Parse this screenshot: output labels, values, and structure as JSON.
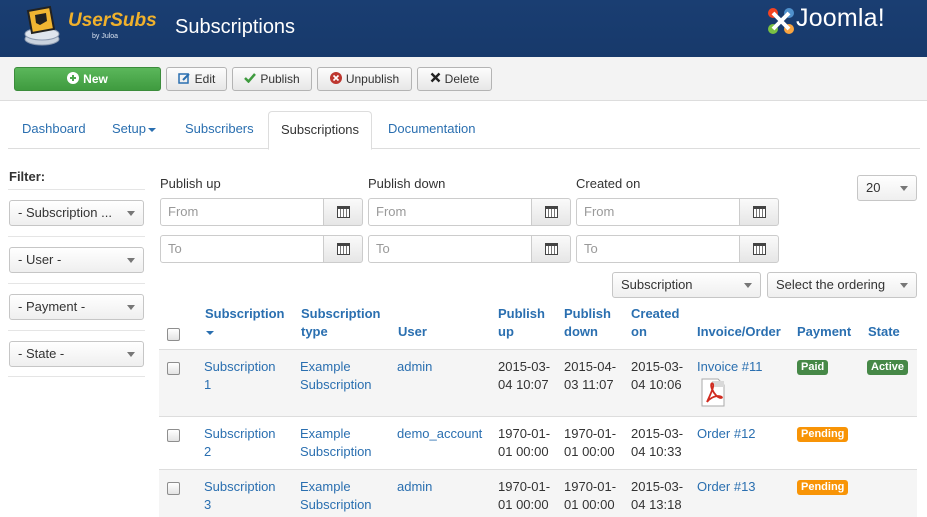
{
  "header": {
    "brand": "UserSubs",
    "brand_sub": "by Juloa",
    "title": "Subscriptions",
    "cms": "Joomla!"
  },
  "toolbar": {
    "new": "New",
    "edit": "Edit",
    "publish": "Publish",
    "unpublish": "Unpublish",
    "delete": "Delete"
  },
  "tabs": [
    "Dashboard",
    "Setup",
    "Subscribers",
    "Subscriptions",
    "Documentation"
  ],
  "sidebar": {
    "filter_label": "Filter:",
    "filters": [
      "- Subscription ...",
      "- User -",
      "- Payment -",
      "- State -"
    ]
  },
  "date_filters": {
    "publish_up": "Publish up",
    "publish_down": "Publish down",
    "created_on": "Created on",
    "from_placeholder": "From",
    "to_placeholder": "To"
  },
  "list_limit": "20",
  "sort_field": "Subscription",
  "ordering": "Select the ordering",
  "columns": [
    "Subscription",
    "Subscription type",
    "User",
    "Publish up",
    "Publish down",
    "Created on",
    "Invoice/Order",
    "Payment",
    "State"
  ],
  "rows": [
    {
      "subscription": [
        "Subscription",
        "1"
      ],
      "type": [
        "Example",
        "Subscription"
      ],
      "user": "admin",
      "publish_up": [
        "2015-03-",
        "04 10:07"
      ],
      "publish_down": [
        "2015-04-",
        "03 11:07"
      ],
      "created_on": [
        "2015-03-",
        "04 10:06"
      ],
      "invoice": "Invoice #11",
      "payment": "Paid",
      "state": "Active"
    },
    {
      "subscription": [
        "Subscription",
        "2"
      ],
      "type": [
        "Example",
        "Subscription"
      ],
      "user": "demo_account",
      "publish_up": [
        "1970-01-",
        "01 00:00"
      ],
      "publish_down": [
        "1970-01-",
        "01 00:00"
      ],
      "created_on": [
        "2015-03-",
        "04 10:33"
      ],
      "invoice": "Order #12",
      "payment": "Pending",
      "state": ""
    },
    {
      "subscription": [
        "Subscription",
        "3"
      ],
      "type": [
        "Example",
        "Subscription"
      ],
      "user": "admin",
      "publish_up": [
        "1970-01-",
        "01 00:00"
      ],
      "publish_down": [
        "1970-01-",
        "01 00:00"
      ],
      "created_on": [
        "2015-03-",
        "04 13:18"
      ],
      "invoice": "Order #13",
      "payment": "Pending",
      "state": ""
    }
  ],
  "colors": {
    "header_bg": "#1a3e72",
    "link": "#2a6fb0",
    "new_button": "#4ca74c",
    "paid_badge": "#468847",
    "active_badge": "#468847",
    "pending_badge": "#f89406"
  }
}
